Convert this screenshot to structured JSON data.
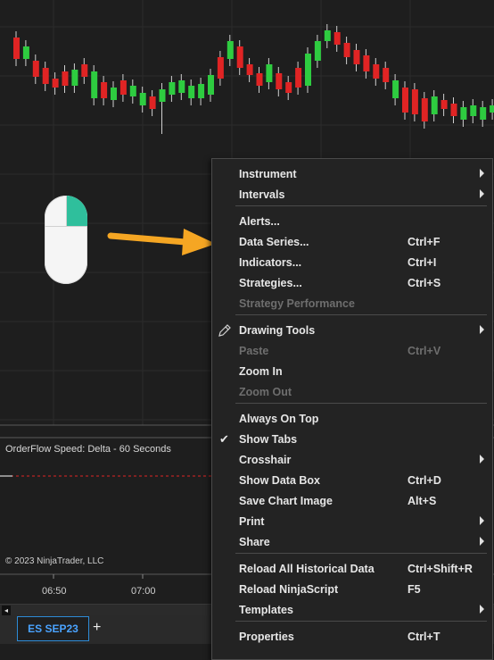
{
  "panel": {
    "indicator_title": "OrderFlow Speed: Delta - 60 Seconds"
  },
  "copyright": "© 2023 NinjaTrader, LLC",
  "time_axis": [
    "06:50",
    "07:00"
  ],
  "tab": {
    "label": "ES SEP23",
    "add": "+"
  },
  "scroll": {
    "left_arrow": "◂"
  },
  "colors": {
    "up": "#2ecc40",
    "down": "#e02424",
    "accent": "#f5a623",
    "tab_border": "#2d8bd6"
  },
  "candles_up": [
    0,
    1,
    0,
    0,
    0,
    0,
    1,
    0,
    1,
    0,
    1,
    0,
    1,
    1,
    0,
    1,
    1,
    1,
    1,
    1,
    1,
    0,
    1,
    0,
    0,
    0,
    1,
    0,
    0,
    0,
    1,
    1,
    1,
    0,
    0,
    0,
    0,
    0,
    0,
    1,
    0,
    0,
    0,
    1,
    0,
    0,
    1,
    1,
    1,
    1,
    0
  ],
  "menu": {
    "items": [
      {
        "label": "Instrument",
        "shortcut": "",
        "submenu": true,
        "disabled": false
      },
      {
        "label": "Intervals",
        "shortcut": "",
        "submenu": true,
        "disabled": false
      },
      {
        "label": "Alerts...",
        "shortcut": "",
        "submenu": false,
        "disabled": false
      },
      {
        "label": "Data Series...",
        "shortcut": "Ctrl+F",
        "submenu": false,
        "disabled": false
      },
      {
        "label": "Indicators...",
        "shortcut": "Ctrl+I",
        "submenu": false,
        "disabled": false
      },
      {
        "label": "Strategies...",
        "shortcut": "Ctrl+S",
        "submenu": false,
        "disabled": false
      },
      {
        "label": "Strategy Performance",
        "shortcut": "",
        "submenu": false,
        "disabled": true
      },
      {
        "label": "Drawing Tools",
        "shortcut": "",
        "submenu": true,
        "disabled": false,
        "icon": "pencil-icon"
      },
      {
        "label": "Paste",
        "shortcut": "Ctrl+V",
        "submenu": false,
        "disabled": true
      },
      {
        "label": "Zoom In",
        "shortcut": "",
        "submenu": false,
        "disabled": false
      },
      {
        "label": "Zoom Out",
        "shortcut": "",
        "submenu": false,
        "disabled": true
      },
      {
        "label": "Always On Top",
        "shortcut": "",
        "submenu": false,
        "disabled": false
      },
      {
        "label": "Show Tabs",
        "shortcut": "",
        "submenu": false,
        "disabled": false,
        "checked": true
      },
      {
        "label": "Crosshair",
        "shortcut": "",
        "submenu": true,
        "disabled": false
      },
      {
        "label": "Show Data Box",
        "shortcut": "Ctrl+D",
        "submenu": false,
        "disabled": false
      },
      {
        "label": "Save Chart Image",
        "shortcut": "Alt+S",
        "submenu": false,
        "disabled": false
      },
      {
        "label": "Print",
        "shortcut": "",
        "submenu": true,
        "disabled": false
      },
      {
        "label": "Share",
        "shortcut": "",
        "submenu": true,
        "disabled": false
      },
      {
        "label": "Reload All Historical Data",
        "shortcut": "Ctrl+Shift+R",
        "submenu": false,
        "disabled": false
      },
      {
        "label": "Reload NinjaScript",
        "shortcut": "F5",
        "submenu": false,
        "disabled": false
      },
      {
        "label": "Templates",
        "shortcut": "",
        "submenu": true,
        "disabled": false
      },
      {
        "label": "Properties",
        "shortcut": "Ctrl+T",
        "submenu": false,
        "disabled": false
      }
    ]
  }
}
